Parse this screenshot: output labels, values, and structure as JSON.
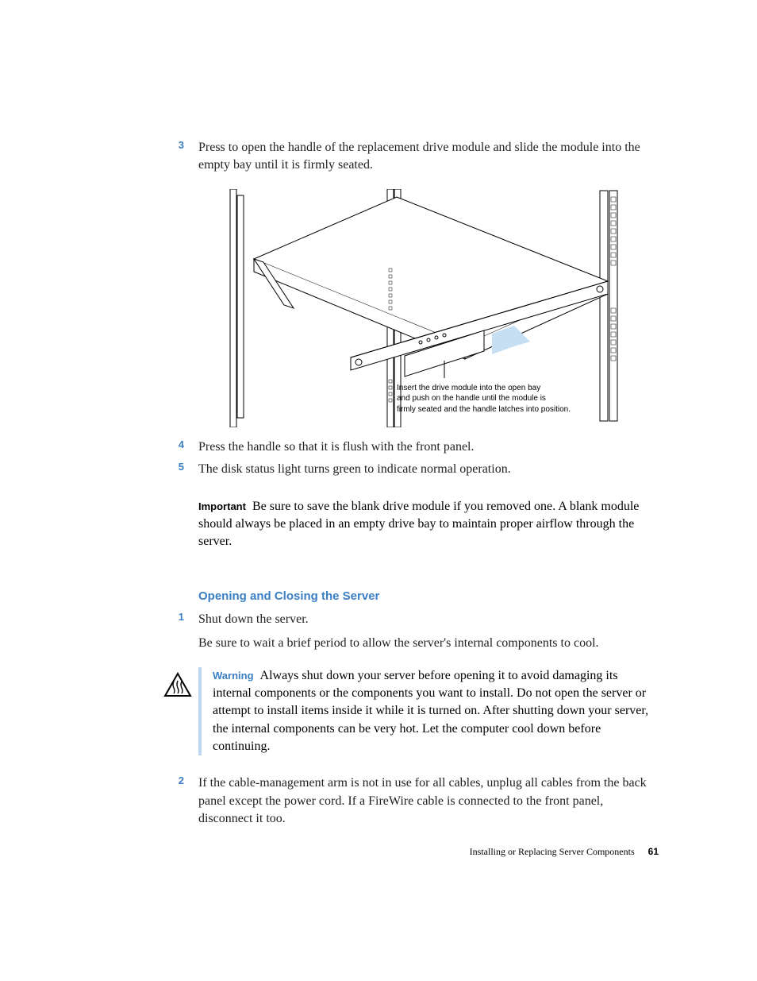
{
  "steps_a": {
    "n3": "3",
    "t3": "Press to open the handle of the replacement drive module and slide the module into the empty bay until it is firmly seated.",
    "n4": "4",
    "t4": "Press the handle so that it is flush with the front panel.",
    "n5": "5",
    "t5": "The disk status light turns green to indicate normal operation."
  },
  "figure": {
    "caption_l1": "Insert the drive module into the open bay",
    "caption_l2": "and push on the handle until the module is",
    "caption_l3": "firmly seated and the handle latches into position."
  },
  "important": {
    "label": "Important",
    "text": "Be sure to save the blank drive module if you removed one. A blank module should always be placed in an empty drive bay to maintain proper airflow through the server."
  },
  "section": {
    "heading": "Opening and Closing the Server"
  },
  "steps_b": {
    "n1": "1",
    "t1": "Shut down the server.",
    "t1b": "Be sure to wait a brief period to allow the server's internal components to cool.",
    "n2": "2",
    "t2": "If the cable-management arm is not in use for all cables, unplug all cables from the back panel except the power cord. If a FireWire cable is connected to the front panel, disconnect it too."
  },
  "warning": {
    "label": "Warning",
    "text": "Always shut down your server before opening it to avoid damaging its internal components or the components you want to install. Do not open the server or attempt to install items inside it while it is turned on. After shutting down your server, the internal components can be very hot. Let the computer cool down before continuing."
  },
  "footer": {
    "text": "Installing or Replacing Server Components",
    "page": "61"
  }
}
